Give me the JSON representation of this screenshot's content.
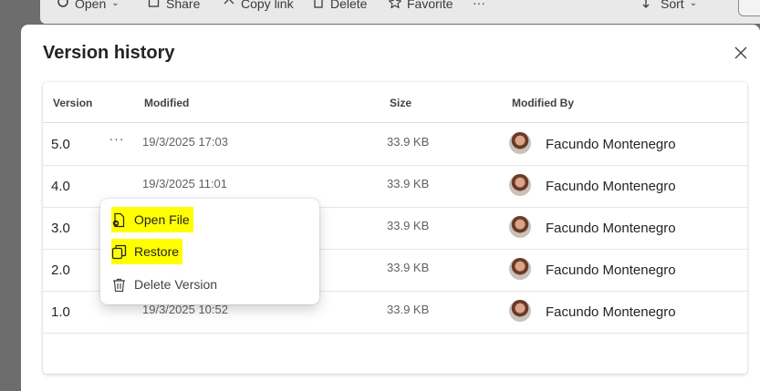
{
  "background_toolbar": {
    "items": [
      {
        "label": "Open",
        "icon": "open-icon"
      },
      {
        "label": "Share",
        "icon": "share-icon"
      },
      {
        "label": "Copy link",
        "icon": "link-icon"
      },
      {
        "label": "Delete",
        "icon": "trash-icon"
      },
      {
        "label": "Favorite",
        "icon": "star-icon"
      },
      {
        "label": "···",
        "icon": "more-icon"
      },
      {
        "label": "Sort",
        "icon": "sort-icon"
      }
    ]
  },
  "dialog": {
    "title": "Version history",
    "close_icon": "close-icon",
    "columns": {
      "version": "Version",
      "modified": "Modified",
      "size": "Size",
      "modified_by": "Modified By"
    },
    "rows": [
      {
        "version": "5.0",
        "more": "···",
        "modified": "19/3/2025 17:03",
        "size": "33.9 KB",
        "modified_by": "Facundo Montenegro"
      },
      {
        "version": "4.0",
        "more": "",
        "modified": "19/3/2025 11:01",
        "size": "33.9 KB",
        "modified_by": "Facundo Montenegro"
      },
      {
        "version": "3.0",
        "more": "",
        "modified": "",
        "size": "33.9 KB",
        "modified_by": "Facundo Montenegro"
      },
      {
        "version": "2.0",
        "more": "",
        "modified": "",
        "size": "33.9 KB",
        "modified_by": "Facundo Montenegro"
      },
      {
        "version": "1.0",
        "more": "",
        "modified": "19/3/2025 10:52",
        "size": "33.9 KB",
        "modified_by": "Facundo Montenegro"
      }
    ]
  },
  "context_menu": {
    "items": [
      {
        "label": "Open File",
        "icon": "open-file-icon",
        "highlighted": true
      },
      {
        "label": "Restore",
        "icon": "restore-icon",
        "highlighted": true
      },
      {
        "label": "Delete Version",
        "icon": "trash-icon",
        "highlighted": false
      }
    ]
  },
  "colors": {
    "highlight": "#ffff00",
    "overlay": "#6d6d6d"
  }
}
